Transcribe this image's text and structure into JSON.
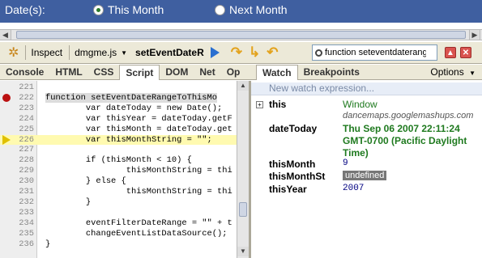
{
  "top_bar": {
    "label": "Date(s):",
    "radio_this_month": "This Month",
    "radio_next_month": "Next Month",
    "selected": "This Month"
  },
  "toolbar": {
    "inspect": "Inspect",
    "file": "dmgme.js",
    "function_name": "setEventDateR",
    "search_value": "function seteventdaterange"
  },
  "tabs": [
    "Console",
    "HTML",
    "CSS",
    "Script",
    "DOM",
    "Net",
    "Op"
  ],
  "active_tab": "Script",
  "right_tabs": [
    "Watch",
    "Breakpoints"
  ],
  "right_active": "Watch",
  "options_label": "Options",
  "source_lines": [
    {
      "num": "221",
      "text": ""
    },
    {
      "num": "222",
      "text": "function setEventDateRangeToThisMo"
    },
    {
      "num": "223",
      "text": "        var dateToday = new Date();"
    },
    {
      "num": "224",
      "text": "        var thisYear = dateToday.getF"
    },
    {
      "num": "225",
      "text": "        var thisMonth = dateToday.get"
    },
    {
      "num": "226",
      "text": "        var thisMonthString = \"\";"
    },
    {
      "num": "227",
      "text": ""
    },
    {
      "num": "228",
      "text": "        if (thisMonth < 10) {"
    },
    {
      "num": "229",
      "text": "                thisMonthString = thi"
    },
    {
      "num": "230",
      "text": "        } else {"
    },
    {
      "num": "231",
      "text": "                thisMonthString = thi"
    },
    {
      "num": "232",
      "text": "        }"
    },
    {
      "num": "233",
      "text": ""
    },
    {
      "num": "234",
      "text": "        eventFilterDateRange = \"\" + t"
    },
    {
      "num": "235",
      "text": "        changeEventListDataSource();"
    },
    {
      "num": "236",
      "text": "}"
    }
  ],
  "watch": {
    "new_expression": "New watch expression...",
    "entries": [
      {
        "name": "this",
        "value": "Window",
        "sub": "dancemaps.googlemashups.com"
      },
      {
        "name": "dateToday",
        "value_lines": [
          "Thu Sep 06 2007 22:11:24",
          "GMT-0700 (Pacific Daylight",
          "Time)"
        ]
      },
      {
        "name": "thisMonth",
        "value": "9"
      },
      {
        "name": "thisMonthSt",
        "value": "undefined"
      },
      {
        "name": "thisYear",
        "value": "2007"
      }
    ]
  },
  "colors": {
    "accent": "#3f5fa0",
    "value_green": "#1f7a1f",
    "breakpoint": "#b11111"
  }
}
